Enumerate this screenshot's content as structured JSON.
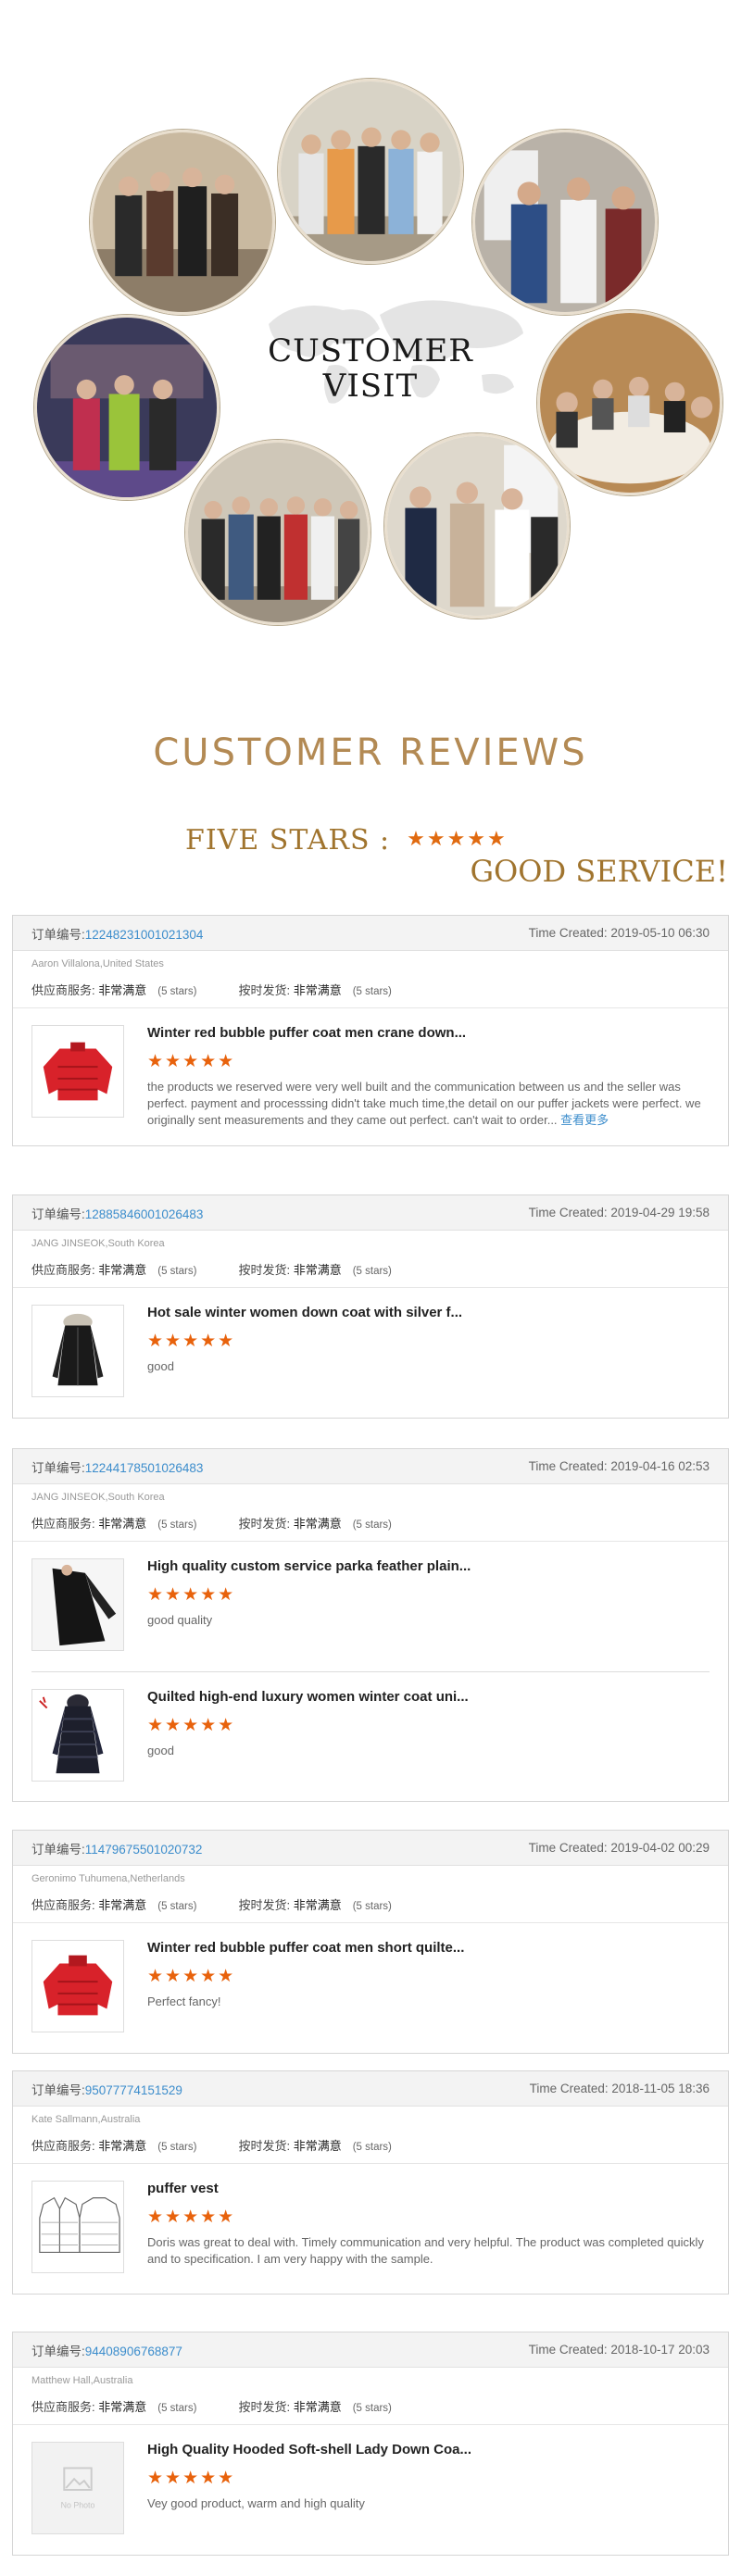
{
  "visit": {
    "title_line1": "CUSTOMER",
    "title_line2": "VISIT"
  },
  "reviews_header": {
    "title": "CUSTOMER    REVIEWS",
    "five_stars_label": "FIVE STARS :",
    "five_stars_glyphs": "★★★★★",
    "good_service": "GOOD SERVICE!"
  },
  "labels": {
    "order_prefix": "订单编号:",
    "time_prefix": "Time Created:",
    "supplier_service": "供应商服务:",
    "on_time_shipping": "按时发货:",
    "very_satisfied": "非常满意",
    "five_stars": "(5 stars)",
    "star_glyphs": "★★★★★",
    "see_more": "查看更多"
  },
  "orders": [
    {
      "order_no": "12248231001021304",
      "time": "2019-05-10 06:30",
      "buyer": "Aaron Villalona,United States",
      "items": [
        {
          "title": "Winter red bubble puffer coat men crane down...",
          "comment": "the products we reserved were very well built and the communication between us and the seller was perfect. payment and processsing didn't take much time,the detail on our puffer jackets were perfect. we originally sent measurements and they came out perfect. can't wait to order...",
          "thumb": "red-puffer-jacket"
        }
      ]
    },
    {
      "order_no": "12885846001026483",
      "time": "2019-04-29 19:58",
      "buyer": "JANG JINSEOK,South Korea",
      "items": [
        {
          "title": "Hot sale winter women down coat with silver f...",
          "comment": "good",
          "thumb": "black-fur-coat"
        }
      ]
    },
    {
      "order_no": "12244178501026483",
      "time": "2019-04-16 02:53",
      "buyer": "JANG JINSEOK,South Korea",
      "items": [
        {
          "title": "High quality custom service parka feather plain...",
          "comment": "good quality",
          "thumb": "black-parka"
        },
        {
          "title": "Quilted high-end luxury women winter coat uni...",
          "comment": "good",
          "thumb": "quilted-long-coat"
        }
      ]
    },
    {
      "order_no": "11479675501020732",
      "time": "2019-04-02 00:29",
      "buyer": "Geronimo Tuhumena,Netherlands",
      "items": [
        {
          "title": "Winter red bubble puffer coat men short quilte...",
          "comment": "Perfect fancy!",
          "thumb": "red-puffer-jacket"
        }
      ]
    },
    {
      "order_no": "95077774151529",
      "time": "2018-11-05 18:36",
      "buyer": "Kate Sallmann,Australia",
      "items": [
        {
          "title": "puffer vest",
          "comment": "Doris was great to deal with. Timely communication and very helpful. The product was completed quickly and to specification. I am very happy with the sample.",
          "thumb": "vest-sketch"
        }
      ]
    },
    {
      "order_no": "94408906768877",
      "time": "2018-10-17 20:03",
      "buyer": "Matthew Hall,Australia",
      "items": [
        {
          "title": "High Quality Hooded Soft-shell Lady Down Coa...",
          "comment": "Vey good product, warm and high quality",
          "thumb": "no-photo",
          "no_photo_label": "No Photo"
        }
      ]
    }
  ],
  "colors": {
    "gold": "#b38a54",
    "link": "#3c8dcc",
    "star": "#e8620c"
  }
}
